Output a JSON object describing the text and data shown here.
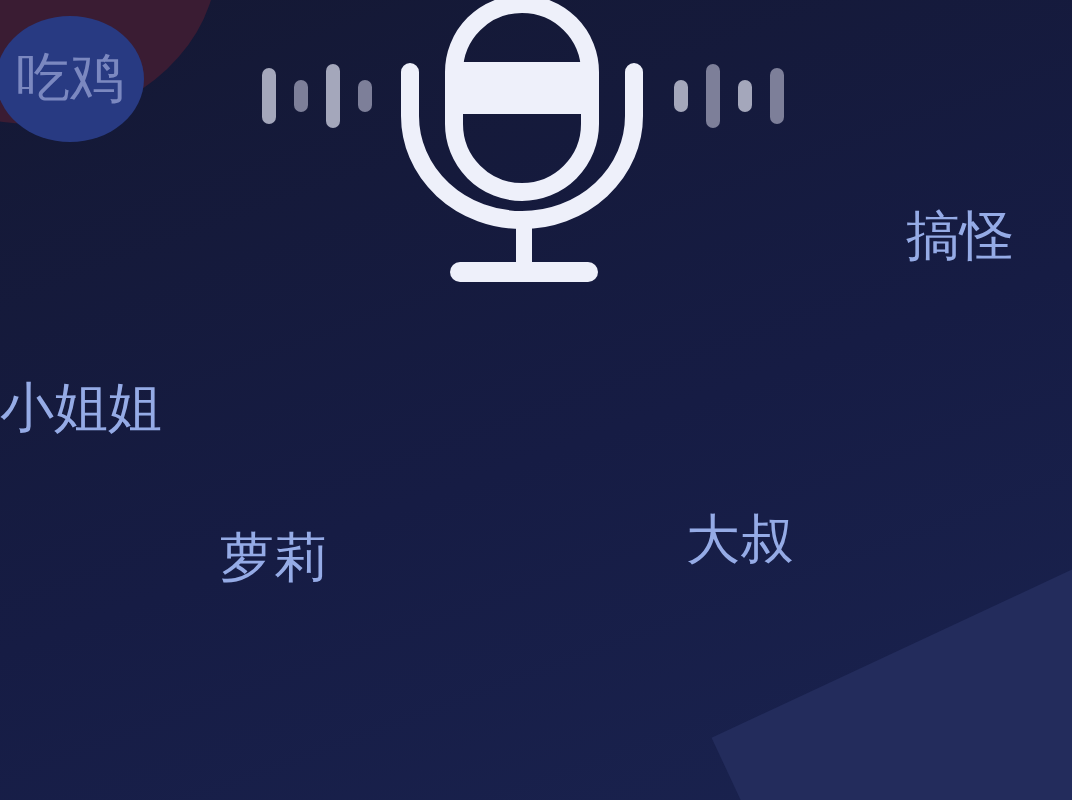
{
  "voices": [
    {
      "label": "吃鸡",
      "selected": true
    },
    {
      "label": "搞怪",
      "selected": false
    },
    {
      "label": "小姐姐",
      "selected": false
    },
    {
      "label": "萝莉",
      "selected": false
    },
    {
      "label": "大叔",
      "selected": false
    }
  ]
}
